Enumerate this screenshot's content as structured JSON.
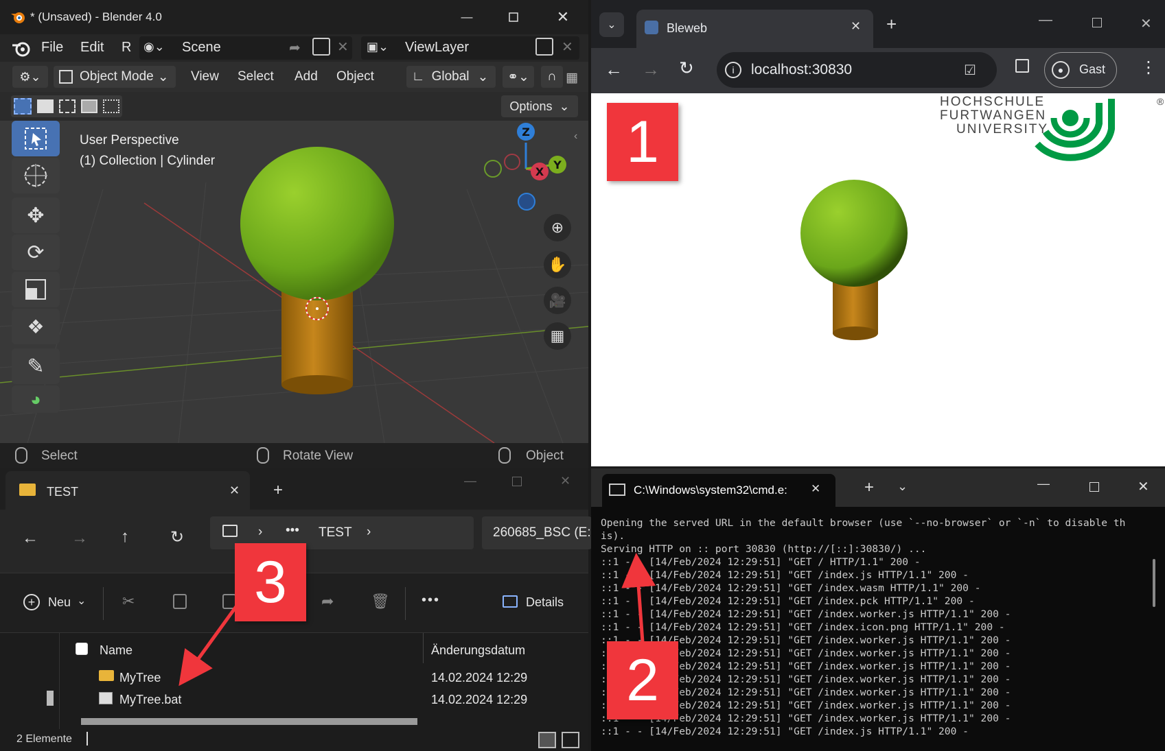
{
  "blender": {
    "title": "* (Unsaved) - Blender 4.0",
    "menu": [
      "File",
      "Edit",
      "R"
    ],
    "scene_label": "Scene",
    "viewlayer_label": "ViewLayer",
    "mode_label": "Object Mode",
    "header_menu": [
      "View",
      "Select",
      "Add",
      "Object"
    ],
    "orientation_label": "Global",
    "options_label": "Options",
    "viewport_info_line1": "User Perspective",
    "viewport_info_line2": "(1) Collection | Cylinder",
    "gizmo_axes": [
      "Z",
      "X",
      "Y"
    ],
    "status_left": "Select",
    "status_middle": "Rotate View",
    "status_right": "Object"
  },
  "browser": {
    "tab_title": "Bleweb",
    "url": "localhost:30830",
    "profile_label": "Gast",
    "logo_lines": [
      "HOCHSCHULE",
      "FURTWANGEN",
      "UNIVERSITY"
    ],
    "logo_mark": "®"
  },
  "explorer": {
    "tab_title": "TEST",
    "breadcrumb_current": "TEST",
    "breadcrumb_more": "•••",
    "search_text": "260685_BSC (E:",
    "new_label": "Neu",
    "more_label": "•••",
    "details_label": "Details",
    "col_name": "Name",
    "col_date": "Änderungsdatum",
    "files": [
      {
        "name": "MyTree",
        "date": "14.02.2024 12:29",
        "type": "folder"
      },
      {
        "name": "MyTree.bat",
        "date": "14.02.2024 12:29",
        "type": "bat"
      }
    ],
    "status_count": "2 Elemente"
  },
  "terminal": {
    "tab_title": "C:\\Windows\\system32\\cmd.e:",
    "lines": [
      "Opening the served URL in the default browser (use `--no-browser` or `-n` to disable th",
      "is).",
      "Serving HTTP on :: port 30830 (http://[::]:30830/) ...",
      "::1 - - [14/Feb/2024 12:29:51] \"GET / HTTP/1.1\" 200 -",
      "::1 - - [14/Feb/2024 12:29:51] \"GET /index.js HTTP/1.1\" 200 -",
      "::1 - - [14/Feb/2024 12:29:51] \"GET /index.wasm HTTP/1.1\" 200 -",
      "::1 - - [14/Feb/2024 12:29:51] \"GET /index.pck HTTP/1.1\" 200 -",
      "::1 - - [14/Feb/2024 12:29:51] \"GET /index.worker.js HTTP/1.1\" 200 -",
      "::1 - - [14/Feb/2024 12:29:51] \"GET /index.icon.png HTTP/1.1\" 200 -",
      "::1 - - [14/Feb/2024 12:29:51] \"GET /index.worker.js HTTP/1.1\" 200 -",
      "::1 - - [14/Feb/2024 12:29:51] \"GET /index.worker.js HTTP/1.1\" 200 -",
      "::1 - - [14/Feb/2024 12:29:51] \"GET /index.worker.js HTTP/1.1\" 200 -",
      "::1 - - [14/Feb/2024 12:29:51] \"GET /index.worker.js HTTP/1.1\" 200 -",
      "::1 - - [14/Feb/2024 12:29:51] \"GET /index.worker.js HTTP/1.1\" 200 -",
      "::1 - - [14/Feb/2024 12:29:51] \"GET /index.worker.js HTTP/1.1\" 200 -",
      "::1 - - [14/Feb/2024 12:29:51] \"GET /index.worker.js HTTP/1.1\" 200 -",
      "::1 - - [14/Feb/2024 12:29:51] \"GET /index.js HTTP/1.1\" 200 -"
    ]
  },
  "annotations": {
    "badge1": "1",
    "badge2": "2",
    "badge3": "3",
    "color": "#f0363c"
  },
  "colors": {
    "tree_crown": "#7fbf1e",
    "tree_trunk": "#b87a10",
    "hfu_green": "#009a44"
  }
}
